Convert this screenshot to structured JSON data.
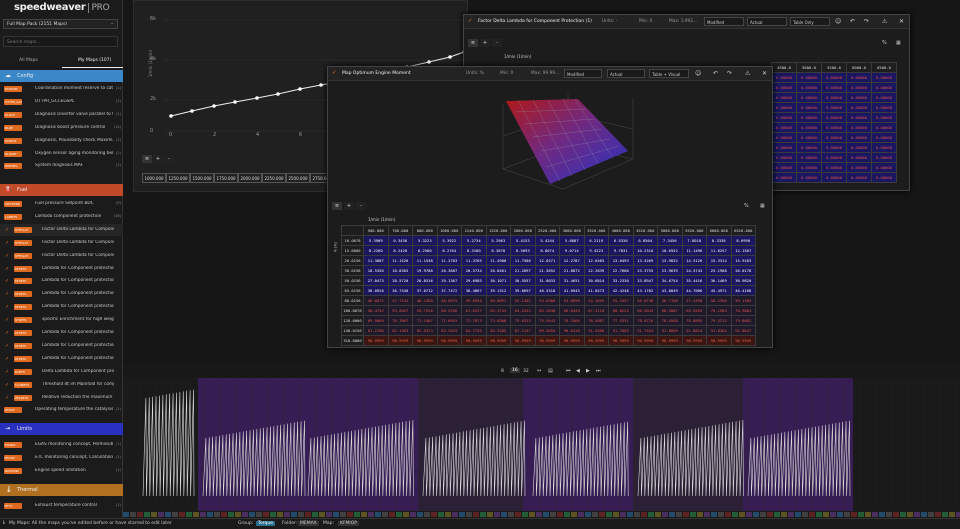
{
  "app": {
    "brand": "speedweaver",
    "edition": "PRO"
  },
  "sidebar": {
    "pack": "Full Map Pack (2151 Maps)",
    "search_placeholder": "Search maps...",
    "tabs": [
      "All Maps",
      "My Maps (107)"
    ],
    "sections": [
      {
        "label": "Config",
        "color": "#3a88c8"
      },
      {
        "label": "Fuel",
        "color": "#c04a28"
      },
      {
        "label": "Limits",
        "color": "#2a30c0"
      },
      {
        "label": "Thermal",
        "color": "#b07020"
      }
    ],
    "config_items": [
      {
        "tag": "ECMAPP",
        "label": "Coordination moment reserve to catalyt...",
        "count": "(1)"
      },
      {
        "tag": "OTTPR_GCC",
        "label": "OTTPR_GCCEGSPL",
        "count": "(1)"
      },
      {
        "tag": "DLRVP",
        "label": "Diagnosis Diverter valve parallel to Co...",
        "count": "(1)"
      },
      {
        "tag": "DLDE",
        "label": "Diagnosis boost pressure control",
        "count": "(14)"
      },
      {
        "tag": "DMDDS",
        "label": "Diagnosis, Plausibility check Maximum...",
        "count": "(1)"
      },
      {
        "tag": "DLSKRT",
        "label": "Oxygen sensor aging monitoring behin...",
        "count": "(2)"
      },
      {
        "tag": "DMFMPL",
        "label": "System diagnosis MAF",
        "count": "(1)"
      }
    ],
    "fuel_items": [
      {
        "tag": "MDVFRDE",
        "label": "Fuel pressure Setpoint BDC",
        "count": "(9)",
        "indent": false,
        "check": false
      },
      {
        "tag": "LAMBTS",
        "label": "Lambda component protection",
        "count": "(16)",
        "indent": false,
        "check": false
      },
      {
        "tag": "KFFDLAT",
        "label": "Factor Delta Lambda for Component pr...",
        "count": "",
        "indent": true,
        "check": true
      },
      {
        "tag": "KFFDLAT",
        "label": "Factor Delta Lambda for Component pr...",
        "count": "",
        "indent": true,
        "check": true
      },
      {
        "tag": "KFFDLAT",
        "label": "Factor Delta Lambda for Component pr...",
        "count": "",
        "indent": true,
        "check": true
      },
      {
        "tag": "KFLBTS",
        "label": "Lambda for Component protection Al o...",
        "count": "",
        "indent": true,
        "check": true
      },
      {
        "tag": "KFLBTS",
        "label": "Lambda for Component protection Al o...",
        "count": "",
        "indent": true,
        "check": true
      },
      {
        "tag": "KFLBTS",
        "label": "Lambda for Component protection Al o...",
        "count": "",
        "indent": true,
        "check": true
      },
      {
        "tag": "KFLBTS",
        "label": "Lambda for Component protection Al o...",
        "count": "",
        "indent": true,
        "check": true
      },
      {
        "tag": "KFLBTS",
        "label": "specific Enrichment for high weigh and...",
        "count": "",
        "indent": true,
        "check": true
      },
      {
        "tag": "KFLBTS",
        "label": "Lambda for Component protection (1)",
        "count": "",
        "indent": true,
        "check": true
      },
      {
        "tag": "KFLBTS",
        "label": "Lambda for Component protection (2)",
        "count": "",
        "indent": true,
        "check": true
      },
      {
        "tag": "KFLBTS",
        "label": "Lambda for Component protection (3)",
        "count": "",
        "indent": true,
        "check": true
      },
      {
        "tag": "DLBTS",
        "label": "Delta Lambda for Component protection",
        "count": "",
        "indent": true,
        "check": true
      },
      {
        "tag": "TLAMBTS",
        "label": "Threshold dt im Manifold for componen...",
        "count": "",
        "indent": true,
        "check": true
      },
      {
        "tag": "ZFKLBTS",
        "label": "Relative reduction the maximum Filling ...",
        "count": "",
        "indent": true,
        "check": true
      },
      {
        "tag": "ZTKAT",
        "label": "Operating temperature the catalysis",
        "count": "(1)",
        "indent": false,
        "check": false
      }
    ],
    "limits_items": [
      {
        "tag": "EGSRZ",
        "label": "EGAS monitoring concept, Permissible...",
        "count": "(1)"
      },
      {
        "tag": "ETCRZ",
        "label": "ETC monitoring concept, Calculation o...",
        "count": "(1)"
      },
      {
        "tag": "NMAXMD",
        "label": "Engine speed limitation",
        "count": "(1)"
      }
    ],
    "thermal_items": [
      {
        "tag": "ETTV",
        "label": "Exhaust temperature control",
        "count": "(1)"
      }
    ]
  },
  "bg_chart": {
    "y_ticks": [
      "6k",
      "4k",
      "2k",
      "0"
    ],
    "x_ticks": [
      "0",
      "2",
      "4",
      "6",
      "8",
      "10",
      "12",
      "14"
    ],
    "axis_row": [
      "1000.000",
      "1250.000",
      "1500.000",
      "1750.000",
      "2000.000",
      "2250.000",
      "2500.000",
      "2750.000"
    ],
    "ylabel": "1/min (1/min)"
  },
  "win_factor": {
    "title": "Factor Delta Lambda for Component Protection (1)",
    "units": "Units: -",
    "min": "Min: 0",
    "max": "Max: 1.992...",
    "mode": "Modified",
    "source": "Actual",
    "view": "Table Only",
    "axis_label": "1/min (1/min)",
    "col_headers": [
      "4500.0",
      "5000.0",
      "5500.0",
      "6000.0",
      "6500.0"
    ],
    "rows": [
      [
        "0.00000",
        "0.00000",
        "0.00000",
        "0.00000",
        "0.00000"
      ],
      [
        "0.00000",
        "0.00000",
        "0.00000",
        "0.00000",
        "0.00000"
      ],
      [
        "0.00000",
        "0.00000",
        "0.00000",
        "0.00000",
        "0.00000"
      ],
      [
        "0.00000",
        "0.00000",
        "0.00000",
        "0.00000",
        "0.00000"
      ],
      [
        "0.00000",
        "0.00000",
        "0.00000",
        "0.00000",
        "0.00000"
      ],
      [
        "0.00000",
        "0.00000",
        "0.00000",
        "0.00000",
        "0.00000"
      ],
      [
        "0.00000",
        "0.00000",
        "0.00000",
        "0.00000",
        "0.00000"
      ],
      [
        "0.00000",
        "0.00000",
        "0.00000",
        "0.00000",
        "0.00000"
      ],
      [
        "0.00000",
        "0.00000",
        "0.00000",
        "0.00000",
        "0.00000"
      ],
      [
        "0.00000",
        "0.00000",
        "0.00000",
        "0.00000",
        "0.00000"
      ],
      [
        "0.00000",
        "0.00000",
        "0.00000",
        "0.00000",
        "0.00000"
      ]
    ]
  },
  "win_engine": {
    "title": "Map Optimum Engine Moment",
    "units": "Units: %",
    "min": "Min: 0",
    "max": "Max: 99.99...",
    "mode": "Modified",
    "source": "Actual",
    "view": "Table + Visual",
    "axis_label": "1/min (1/min)",
    "y_axis_label": "% (%)",
    "col_headers": [
      "500.000",
      "700.000",
      "800.000",
      "1000.000",
      "1240.000",
      "1520.000",
      "2000.000",
      "2520.000",
      "3000.000",
      "3520.000",
      "4000.000",
      "4520.000",
      "5000.000",
      "5520.000",
      "6000.000",
      "6520.000"
    ],
    "row_headers": [
      "10.0078",
      "15.0000",
      "20.0156",
      "30.0158",
      "50.0156",
      "65.0156",
      "80.0156",
      "100.0078",
      "120.0000",
      "140.0156",
      "310.0000"
    ],
    "rows": [
      [
        "5.3909",
        "0.3436",
        "5.3223",
        "5.3922",
        "5.2734",
        "5.2963",
        "5.4153",
        "5.4244",
        "5.6807",
        "6.2119",
        "6.5336",
        "6.8504",
        "7.3456",
        "7.8018",
        "8.3336",
        "8.6990"
      ],
      [
        "8.2260",
        "8.2428",
        "8.2500",
        "8.2764",
        "8.3160",
        "8.3878",
        "8.5693",
        "8.8074",
        "9.0714",
        "9.4223",
        "9.7831",
        "10.2310",
        "10.6552",
        "11.1496",
        "11.6257",
        "12.1587"
      ],
      [
        "11.3887",
        "11.1526",
        "11.1538",
        "11.2783",
        "11.3765",
        "11.4980",
        "11.7586",
        "12.0271",
        "12.2787",
        "12.6465",
        "13.0493",
        "13.5269",
        "13.9832",
        "14.5126",
        "15.3314",
        "15.9183"
      ],
      [
        "18.5356",
        "18.8303",
        "19.9788",
        "20.3687",
        "20.5734",
        "20.8461",
        "21.2097",
        "21.5852",
        "21.8872",
        "22.2839",
        "22.7600",
        "23.3755",
        "23.9639",
        "24.5743",
        "25.1988",
        "26.0178"
      ],
      [
        "27.8473",
        "28.5720",
        "28.8316",
        "29.1367",
        "29.6985",
        "30.1071",
        "30.5557",
        "31.0033",
        "31.4651",
        "30.6814",
        "33.2330",
        "33.8947",
        "34.6754",
        "35.4416",
        "36.1469",
        "36.9820"
      ],
      [
        "36.0926",
        "36.7340",
        "37.0712",
        "37.7472",
        "38.4867",
        "39.1312",
        "39.8697",
        "40.5318",
        "41.0945",
        "41.8473",
        "42.4248",
        "43.1702",
        "43.8049",
        "44.7006",
        "45.4971",
        "46.4168"
      ],
      [
        "46.6872",
        "47.7142",
        "48.1360",
        "48.6975",
        "49.6958",
        "50.8891",
        "52.1302",
        "53.0380",
        "53.6890",
        "54.3655",
        "55.2557",
        "56.0748",
        "56.7158",
        "57.4390",
        "58.2350",
        "59.1385"
      ],
      [
        "58.4752",
        "59.0567",
        "59.7528",
        "60.5336",
        "61.6237",
        "62.4743",
        "64.2432",
        "65.2648",
        "66.6449",
        "67.3118",
        "68.0223",
        "68.5043",
        "68.9087",
        "69.5493",
        "70.1983",
        "70.9884"
      ],
      [
        "69.9660",
        "70.7867",
        "71.1487",
        "71.6925",
        "72.7873",
        "73.6308",
        "75.0323",
        "75.9443",
        "76.3466",
        "76.5087",
        "77.5331",
        "78.0716",
        "78.5508",
        "78.8693",
        "79.5213",
        "79.8662"
      ],
      [
        "81.2780",
        "82.1303",
        "82.5373",
        "83.2029",
        "84.1755",
        "85.2585",
        "87.2147",
        "89.3050",
        "90.0416",
        "91.4368",
        "91.7003",
        "91.7454",
        "91.8809",
        "91.8824",
        "91.8304",
        "92.0647"
      ],
      [
        "98.9999",
        "98.9999",
        "98.9999",
        "98.9999",
        "98.9999",
        "98.9999",
        "98.9999",
        "98.9999",
        "98.9999",
        "98.9999",
        "98.9999",
        "98.9999",
        "98.9999",
        "98.9999",
        "98.9999",
        "98.9999"
      ]
    ]
  },
  "timeline": {
    "zoom": [
      "8",
      "16",
      "32"
    ]
  },
  "status": {
    "message": "My Maps: All the maps you've edited before or have starred to edit later",
    "group_label": "Group:",
    "group": "Torque",
    "folder_label": "Folder:",
    "folder": "MEMAX",
    "map_label": "Map:",
    "map": "KFMIOP"
  }
}
